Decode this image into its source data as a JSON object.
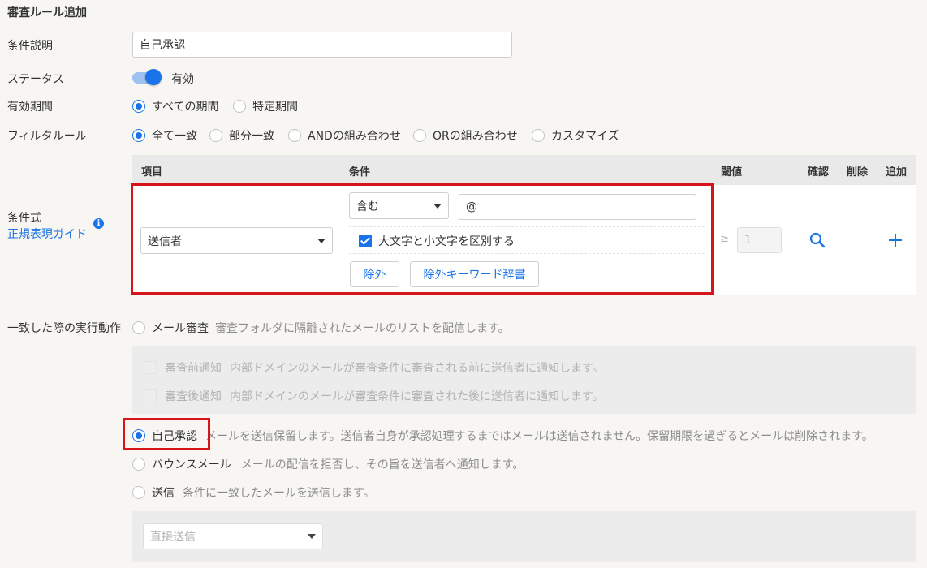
{
  "page": {
    "title": "審査ルール追加"
  },
  "labels": {
    "description": "条件説明",
    "status": "ステータス",
    "period": "有効期間",
    "filter_rule": "フィルタルール",
    "condition_expr": "条件式",
    "regex_guide": "正規表現ガイド",
    "action": "一致した際の実行動作"
  },
  "description_value": "自己承認",
  "status": {
    "text": "有効",
    "enabled": true
  },
  "period": {
    "options": [
      "すべての期間",
      "特定期間"
    ],
    "selected": 0
  },
  "filter_rule": {
    "options": [
      "全て一致",
      "部分一致",
      "ANDの組み合わせ",
      "ORの組み合わせ",
      "カスタマイズ"
    ],
    "selected": 0
  },
  "table": {
    "headers": {
      "item": "項目",
      "condition": "条件",
      "threshold": "閾値",
      "confirm": "確認",
      "delete": "削除",
      "add": "追加"
    },
    "row": {
      "item": "送信者",
      "operator": "含む",
      "keyword": "@",
      "case_sensitive_label": "大文字と小文字を区別する",
      "case_sensitive": true,
      "exclude_button": "除外",
      "exclude_dict_button": "除外キーワード辞書",
      "threshold_symbol": "≥",
      "threshold_value": "1"
    }
  },
  "actions": {
    "review": {
      "label": "メール審査",
      "desc": "審査フォルダに隔離されたメールのリストを配信します。"
    },
    "pre_notify": {
      "label": "審査前通知",
      "desc": "内部ドメインのメールが審査条件に審査される前に送信者に通知します。"
    },
    "post_notify": {
      "label": "審査後通知",
      "desc": "内部ドメインのメールが審査条件に審査された後に送信者に通知します。"
    },
    "self_approval": {
      "label": "自己承認",
      "desc": "メールを送信保留します。送信者自身が承認処理するまではメールは送信されません。保留期限を過ぎるとメールは削除されます。"
    },
    "bounce": {
      "label": "バウンスメール",
      "desc": "メールの配信を拒否し、その旨を送信者へ通知します。"
    },
    "send": {
      "label": "送信",
      "desc": "条件に一致したメールを送信します。"
    },
    "selected": "self_approval",
    "send_mode": "直接送信"
  },
  "colors": {
    "accent": "#1a73e8",
    "highlight": "#d7141a",
    "background": "#f7f6f3"
  }
}
